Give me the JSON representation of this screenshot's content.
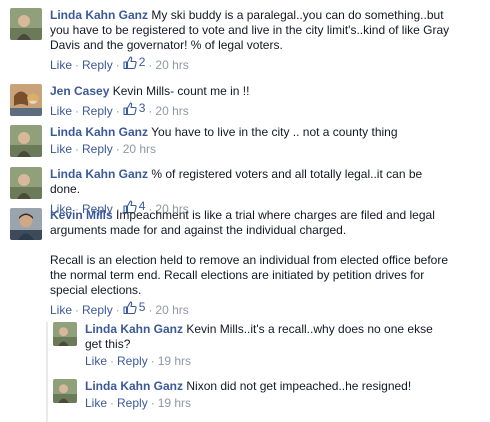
{
  "ui": {
    "like": "Like",
    "reply": "Reply",
    "dot": "·"
  },
  "comments": [
    {
      "name": "Linda Kahn Ganz",
      "text": "My ski buddy is a paralegal..you can do something..but you have to be registered to vote and live in the city limit's..kind of like Gray Davis and the governator! % of legal voters.",
      "likes": "2",
      "time": "20 hrs"
    },
    {
      "name": "Jen Casey",
      "text": "Kevin Mills- count me in !!",
      "likes": "3",
      "time": "20 hrs"
    },
    {
      "name": "Linda Kahn Ganz",
      "text": "You have to live in the city .. not a county thing",
      "time": "20 hrs"
    },
    {
      "name": "Linda Kahn Ganz",
      "text": "% of registered voters and all totally legal..it can be done.",
      "likes": "4",
      "time": "20 hrs"
    },
    {
      "name": "Kevin Mills",
      "text": "Impeachment is like a trial where charges are filed and legal arguments made for and against the individual charged.",
      "text2": "Recall is an election held to remove an individual from elected office before the normal term end. Recall elections are initiated by petition drives for special elections.",
      "likes": "5",
      "time": "20 hrs"
    }
  ],
  "replies": [
    {
      "name": "Linda Kahn Ganz",
      "text": "Kevin Mills..it's a recall..why does no one ekse get this?",
      "time": "19 hrs"
    },
    {
      "name": "Linda Kahn Ganz",
      "text": "Nixon did not get impeached..he resigned!",
      "time": "19 hrs"
    }
  ]
}
